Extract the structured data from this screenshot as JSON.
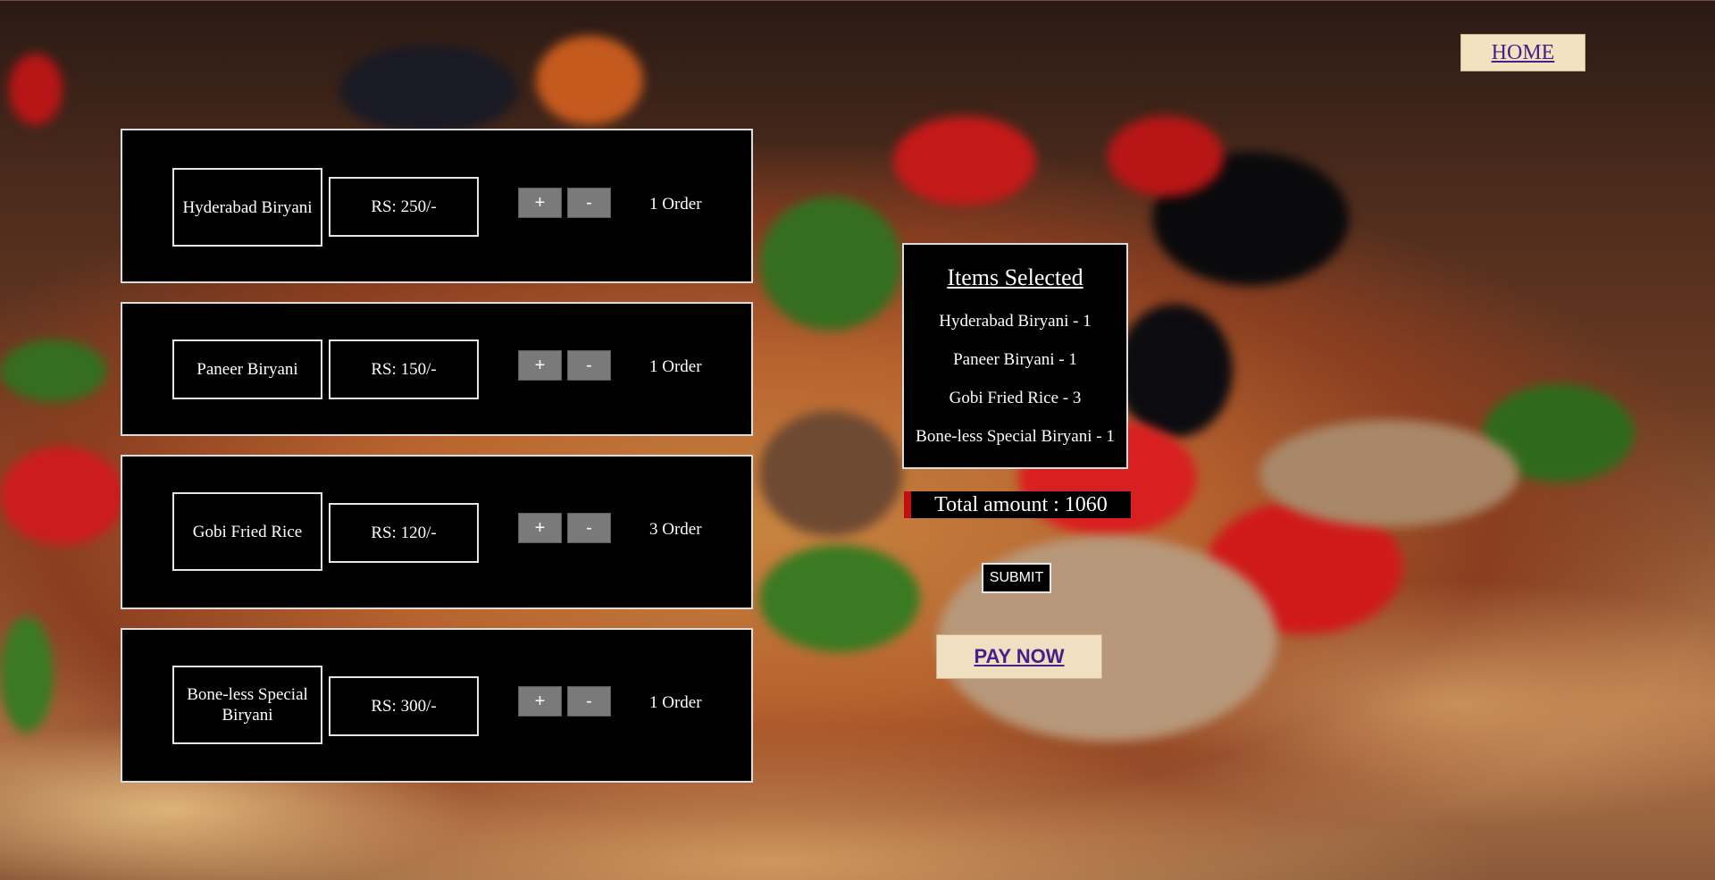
{
  "nav": {
    "home_label": "HOME"
  },
  "menu": {
    "items": [
      {
        "name": "Hyderabad Biryani",
        "price": "RS: 250/-",
        "plus": "+",
        "minus": "-",
        "order": "1 Order"
      },
      {
        "name": "Paneer Biryani",
        "price": "RS: 150/-",
        "plus": "+",
        "minus": "-",
        "order": "1 Order"
      },
      {
        "name": "Gobi Fried Rice",
        "price": "RS: 120/-",
        "plus": "+",
        "minus": "-",
        "order": "3 Order"
      },
      {
        "name": "Bone-less Special Biryani",
        "price": "RS: 300/-",
        "plus": "+",
        "minus": "-",
        "order": "1 Order"
      }
    ]
  },
  "summary": {
    "title": "Items Selected",
    "items": [
      "Hyderabad Biryani - 1",
      "Paneer Biryani - 1",
      "Gobi Fried Rice - 3",
      "Bone-less Special Biryani - 1"
    ],
    "total": "Total amount : 1060"
  },
  "actions": {
    "submit_label": "SUBMIT",
    "pay_label": "PAY NOW"
  },
  "colors": {
    "card_bg": "#000000",
    "qty_button": "#7a7a7a",
    "home_bg": "#f2e2c0",
    "link_text": "#4a1e8a",
    "total_accent": "#c21010"
  }
}
